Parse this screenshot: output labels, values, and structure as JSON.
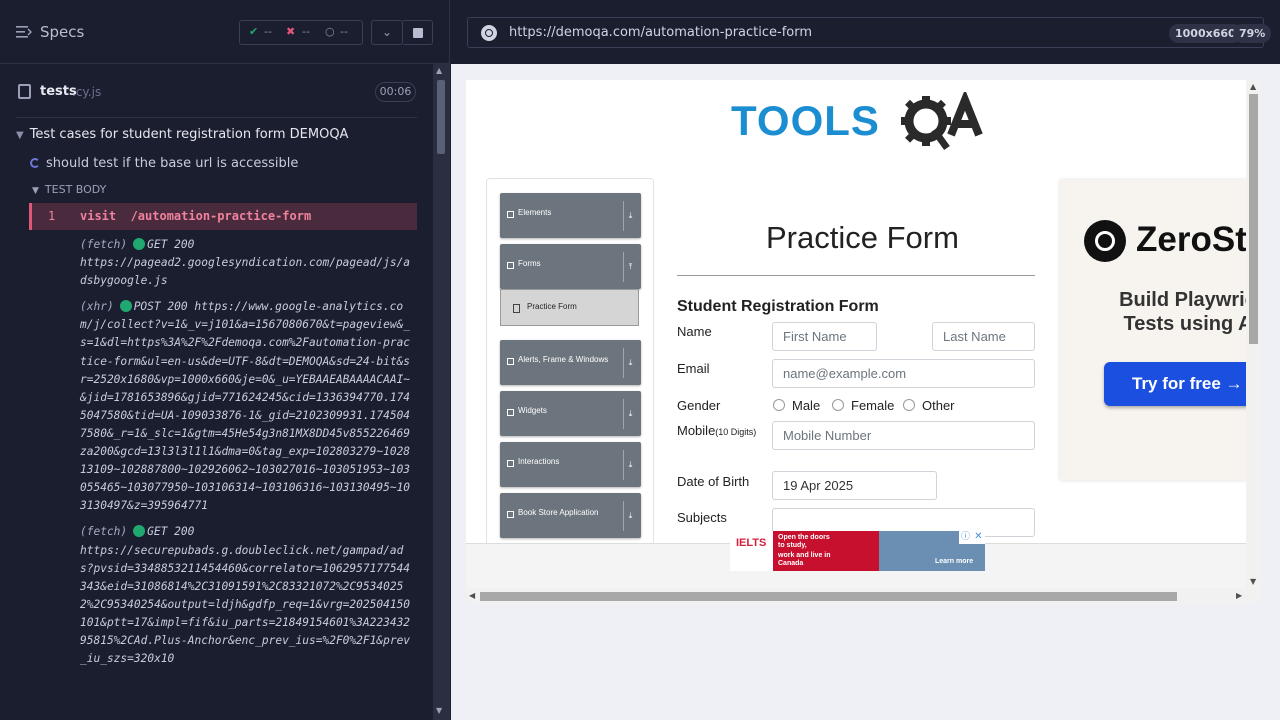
{
  "runner": {
    "specs_label": "Specs",
    "stats": {
      "passed": "--",
      "failed": "--",
      "pending": "--"
    },
    "file_name": "tests",
    "file_ext": ".cy.js",
    "timer": "00:06",
    "suite_title": "Test cases for student registration form DEMOQA",
    "test_title": "should test if the base url is accessible",
    "test_body_label": "TEST BODY",
    "command": {
      "number": "1",
      "name": "visit",
      "arg": "/automation-practice-form"
    },
    "log": [
      {
        "kind": "(fetch)",
        "method": "GET 200",
        "url": "https://pagead2.googlesyndication.com/pagead/js/adsbygoogle.js"
      },
      {
        "kind": "(xhr)",
        "method": "POST 200",
        "url": "https://www.google-analytics.com/j/collect?v=1&_v=j101&a=1567080670&t=pageview&_s=1&dl=https%3A%2F%2Fdemoqa.com%2Fautomation-practice-form&ul=en-us&de=UTF-8&dt=DEMOQA&sd=24-bit&sr=2520x1680&vp=1000x660&je=0&_u=YEBAAEABAAAACAAI~&jid=1781653896&gjid=771624245&cid=1336394770.1745047580&tid=UA-109033876-1&_gid=2102309931.1745047580&_r=1&_slc=1&gtm=45He54g3n81MX8DD45v855226469za200&gcd=13l3l3l1l1&dma=0&tag_exp=102803279~102813109~102887800~102926062~103027016~103051953~103055465~103077950~103106314~103106316~103130495~103130497&z=395964771"
      },
      {
        "kind": "(fetch)",
        "method": "GET 200",
        "url": "https://securepubads.g.doubleclick.net/gampad/ads?pvsid=3348853211454460&correlator=1062957177544343&eid=31086814%2C31091591%2C83321072%2C95340252%2C95340254&output=ldjh&gdfp_req=1&vrg=202504150101&ptt=17&impl=fif&iu_parts=21849154601%3A22343295815%2CAd.Plus-Anchor&enc_prev_ius=%2F0%2F1&prev_iu_szs=320x10"
      }
    ]
  },
  "aut": {
    "url": "https://demoqa.com/automation-practice-form",
    "viewport": "1000x660",
    "zoom": "79%",
    "sidebar": {
      "groups": [
        {
          "label": "Elements"
        },
        {
          "label": "Forms"
        },
        {
          "label": "Alerts, Frame & Windows"
        },
        {
          "label": "Widgets"
        },
        {
          "label": "Interactions"
        },
        {
          "label": "Book Store Application"
        }
      ],
      "active_item": "Practice Form"
    },
    "form": {
      "title": "Practice Form",
      "subtitle": "Student Registration Form",
      "name_label": "Name",
      "first_name_placeholder": "First Name",
      "last_name_placeholder": "Last Name",
      "email_label": "Email",
      "email_placeholder": "name@example.com",
      "gender_label": "Gender",
      "gender_options": [
        "Male",
        "Female",
        "Other"
      ],
      "mobile_label": "Mobile",
      "mobile_hint": "(10 Digits)",
      "mobile_placeholder": "Mobile Number",
      "dob_label": "Date of Birth",
      "dob_value": "19 Apr 2025",
      "subjects_label": "Subjects"
    },
    "ad_right": {
      "brand": "ZeroSt",
      "headline_1": "Build Playwrig",
      "headline_2": "Tests using A",
      "button": "Try for free →"
    },
    "ad_bottom": {
      "logo": "IELTS",
      "line1": "Open the doors to study,",
      "line2": "work and live in Canada",
      "cta": "Learn more"
    }
  },
  "colors": {
    "runner_bg": "#1b1e2e",
    "command_highlight": "#4a2b3e",
    "command_text": "#f0829c",
    "success_dot": "#1fa971",
    "sidebar_group": "#6c757d",
    "cta_blue": "#1a4fe0"
  }
}
